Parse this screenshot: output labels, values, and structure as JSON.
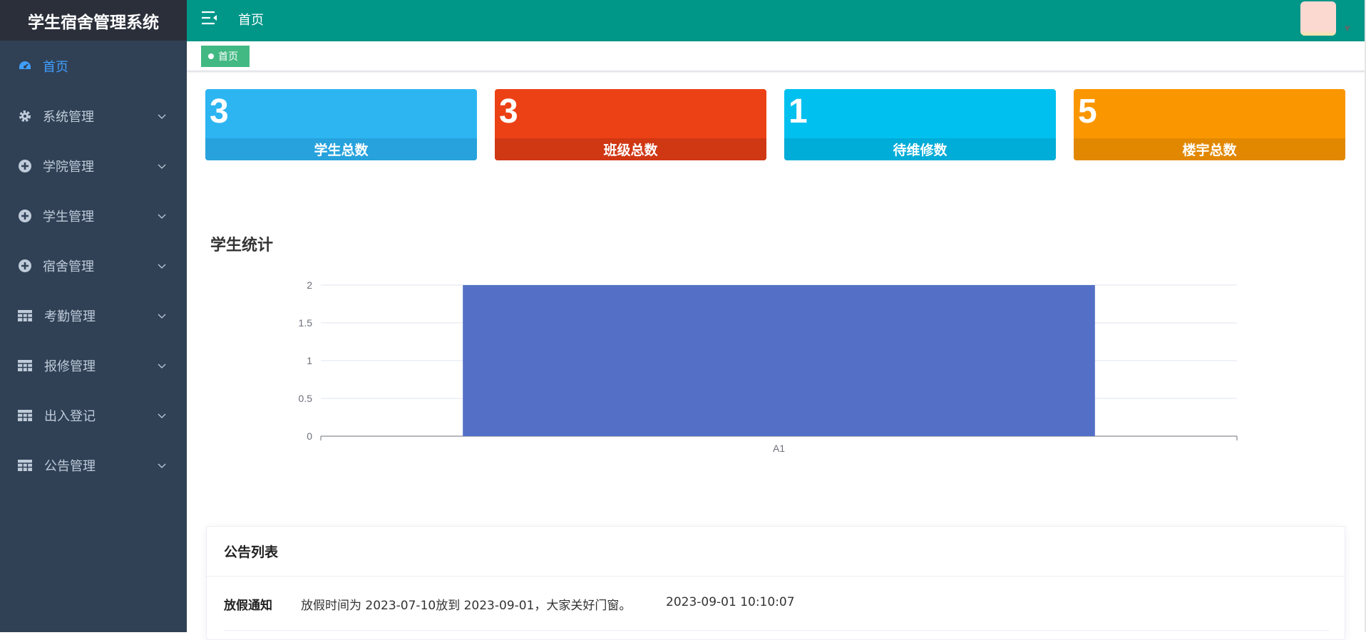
{
  "app": {
    "brand": "学生宿舍管理系统"
  },
  "topbar": {
    "page_title": "首页"
  },
  "tags": [
    {
      "label": "首页"
    }
  ],
  "sidebar": {
    "items": [
      {
        "label": "首页",
        "icon": "dashboard-icon",
        "active": true
      },
      {
        "label": "系统管理",
        "icon": "gear-icon"
      },
      {
        "label": "学院管理",
        "icon": "circle-plus-icon"
      },
      {
        "label": "学生管理",
        "icon": "circle-plus-icon"
      },
      {
        "label": "宿舍管理",
        "icon": "circle-plus-icon"
      },
      {
        "label": "考勤管理",
        "icon": "table-icon"
      },
      {
        "label": "报修管理",
        "icon": "table-icon"
      },
      {
        "label": "出入登记",
        "icon": "table-icon"
      },
      {
        "label": "公告管理",
        "icon": "table-icon"
      }
    ]
  },
  "stats": [
    {
      "value": "3",
      "label": "学生总数",
      "color": "#2db5f2",
      "foot_color": "#27a2dc"
    },
    {
      "value": "3",
      "label": "班级总数",
      "color": "#ec4115",
      "foot_color": "#d03713"
    },
    {
      "value": "1",
      "label": "待维修数",
      "color": "#00c0ef",
      "foot_color": "#00acd8"
    },
    {
      "value": "5",
      "label": "楼宇总数",
      "color": "#fa9600",
      "foot_color": "#e28800"
    }
  ],
  "chart_section": {
    "title": "学生统计"
  },
  "chart_data": {
    "type": "bar",
    "categories": [
      "A1"
    ],
    "values": [
      2
    ],
    "ylim": [
      0,
      2
    ],
    "yticks": [
      "0",
      "0.5",
      "1",
      "1.5",
      "2"
    ],
    "grid": true,
    "bar_color": "#5470c6"
  },
  "notices": {
    "title": "公告列表",
    "items": [
      {
        "title": "放假通知",
        "content": "放假时间为 2023-07-10放到 2023-09-01，大家关好门窗。",
        "time": "2023-09-01 10:10:07"
      }
    ]
  }
}
